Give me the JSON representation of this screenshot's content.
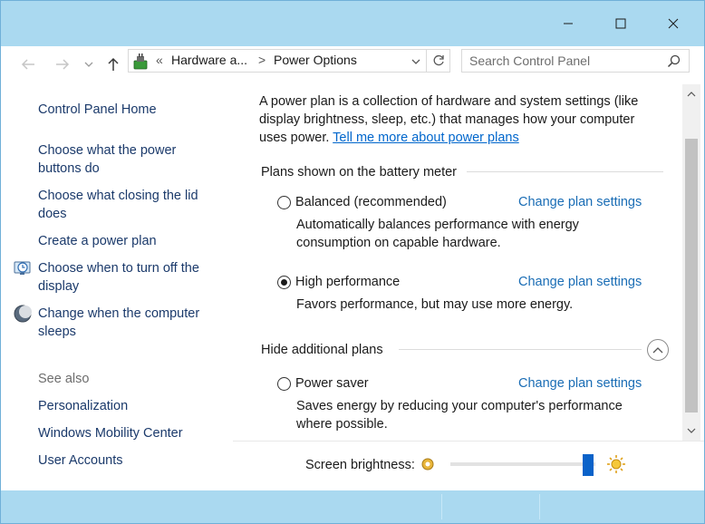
{
  "window": {
    "controls": {
      "minimize": "minimize",
      "maximize": "maximize",
      "close": "close"
    }
  },
  "address_bar": {
    "path_overflow": "«",
    "breadcrumb": [
      "Hardware a...",
      "Power Options"
    ],
    "separator": ">",
    "search_placeholder": "Search Control Panel"
  },
  "sidebar": {
    "home": "Control Panel Home",
    "tasks": [
      {
        "label": "Choose what the power buttons do"
      },
      {
        "label": "Choose what closing the lid does"
      },
      {
        "label": "Create a power plan"
      },
      {
        "label": "Choose when to turn off the display",
        "icon": "display-clock-icon"
      },
      {
        "label": "Change when the computer sleeps",
        "icon": "moon-icon"
      }
    ],
    "see_also_heading": "See also",
    "see_also": [
      "Personalization",
      "Windows Mobility Center",
      "User Accounts"
    ]
  },
  "content": {
    "intro": "A power plan is a collection of hardware and system settings (like display brightness, sleep, etc.) that manages how your computer uses power.",
    "intro_link": "Tell me more about power plans",
    "battery_section": "Plans shown on the battery meter",
    "hidden_section": "Hide additional plans",
    "plans": [
      {
        "name": "Balanced (recommended)",
        "desc": "Automatically balances performance with energy consumption on capable hardware.",
        "selected": false,
        "link": "Change plan settings"
      },
      {
        "name": "High performance",
        "desc": "Favors performance, but may use more energy.",
        "selected": true,
        "link": "Change plan settings"
      },
      {
        "name": "Power saver",
        "desc": "Saves energy by reducing your computer's performance where possible.",
        "selected": false,
        "link": "Change plan settings"
      }
    ]
  },
  "brightness": {
    "label": "Screen brightness:",
    "level": 0.95
  },
  "colors": {
    "titlebar": "#aad9f0",
    "link": "#1a6db5",
    "slider_thumb": "#0a62c9"
  }
}
